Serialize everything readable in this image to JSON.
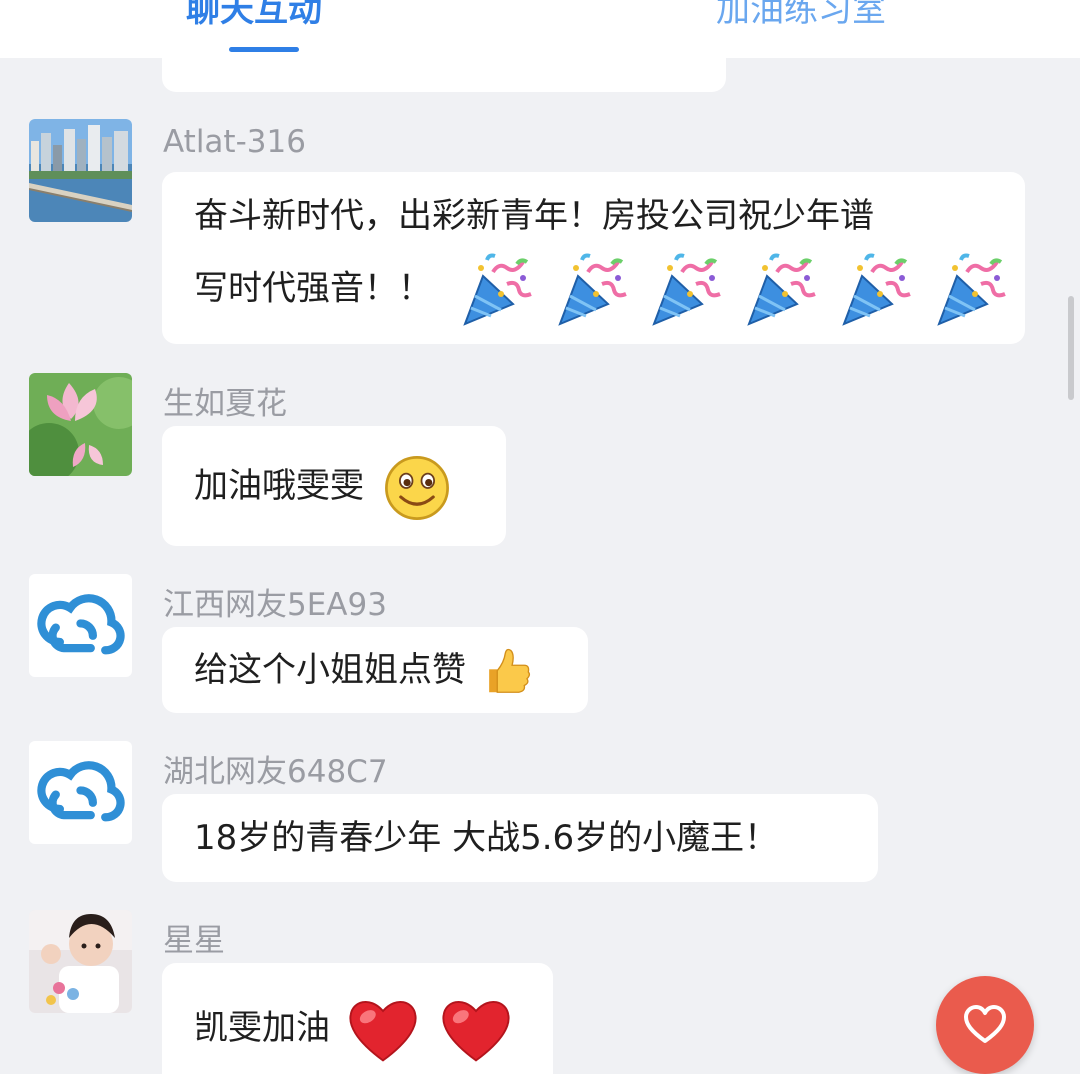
{
  "tabs": [
    {
      "label": "聊天互动",
      "active": true
    },
    {
      "label": "加油练习室",
      "active": false
    }
  ],
  "accent_color": "#2f7fe6",
  "messages": [
    {
      "user": "Atlat-316",
      "avatar": "city-bridge-photo",
      "text_line1": "奋斗新时代，出彩新青年！房投公司祝少年谱",
      "text_line2": "写时代强音！！",
      "emojis": [
        "party-popper-emoji",
        "party-popper-emoji",
        "party-popper-emoji",
        "party-popper-emoji",
        "party-popper-emoji",
        "party-popper-emoji"
      ]
    },
    {
      "user": "生如夏花",
      "avatar": "lotus-flower-photo",
      "text": "加油哦雯雯",
      "emojis": [
        "smile-emoji"
      ]
    },
    {
      "user": "江西网友5EA93",
      "avatar": "cloud-logo-icon",
      "text": "给这个小姐姐点赞",
      "emojis": [
        "thumbs-up-emoji"
      ]
    },
    {
      "user": "湖北网友648C7",
      "avatar": "cloud-logo-icon",
      "text": "18岁的青春少年 大战5.6岁的小魔王！"
    },
    {
      "user": "星星",
      "avatar": "child-photo",
      "text": "凯雯加油",
      "emojis": [
        "red-heart-emoji",
        "red-heart-emoji"
      ]
    }
  ],
  "like_button_icon": "heart-outline-icon",
  "like_button_color": "#ea5b4d"
}
